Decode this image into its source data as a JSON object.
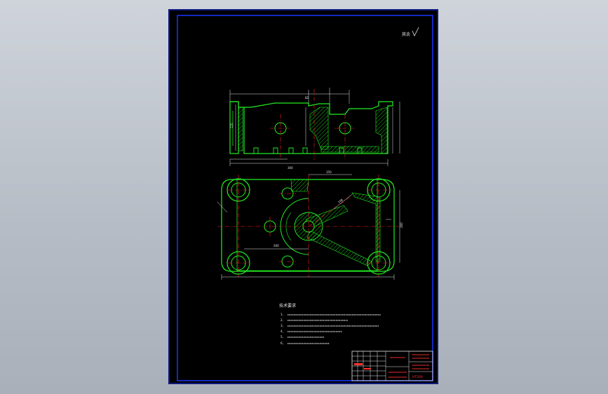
{
  "colors": {
    "background": "#b7bdc6",
    "sheet": "#000000",
    "border": "#1a35ff",
    "outline": "#22ee22",
    "centerline": "#ff2020",
    "dimension": "#e8e8e8",
    "title_block_text": "#ff3030"
  },
  "drawing": {
    "roughness_mark": "其余",
    "tech_requirements": {
      "title": "技术要求",
      "items": [
        "1、",
        "2、",
        "3、",
        "4、",
        "5、",
        "6、"
      ]
    },
    "title_block": {
      "part_name": "",
      "company": "",
      "material": "HT200"
    }
  }
}
